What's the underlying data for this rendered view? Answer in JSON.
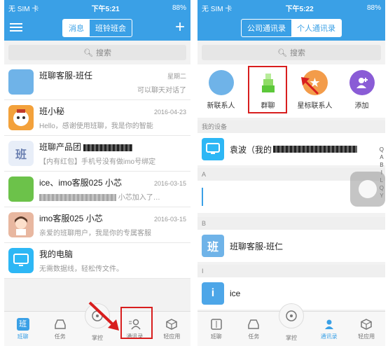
{
  "left": {
    "status": {
      "carrier": "无 SIM 卡",
      "time": "下午5:21",
      "battery": "88%"
    },
    "nav": {
      "seg_active": "消息",
      "seg_inactive": "班铃班会",
      "add": "+"
    },
    "search_placeholder": "搜索",
    "chats": [
      {
        "name": "班聊客服-班任",
        "date": "星期二",
        "preview": "可以聊天对话了",
        "color": "#6fb3e8"
      },
      {
        "name": "班小秘",
        "date": "2016-04-23",
        "preview": "Hello，感谢使用班聊，我是你的智能",
        "color": "#f3a13b"
      },
      {
        "name": "班聊产品团",
        "date": "",
        "preview": "【内有红包】手机号没有做imo号绑定",
        "color": "#c8d4ea",
        "avatar_text": "班"
      },
      {
        "name": "ice、imo客服025 小芯",
        "date": "2016-03-15",
        "preview": "小芯加入了…",
        "color": "#6cc24a"
      },
      {
        "name": "imo客服025 小芯",
        "date": "2016-03-15",
        "preview": "亲爱的班聊用户，我是你的专属客服",
        "color": "#e8b7a0"
      },
      {
        "name": "我的电脑",
        "date": "",
        "preview": "无需数据线，轻松传文件。",
        "color": "#2db7f5"
      }
    ],
    "tabs": [
      "班聊",
      "任务",
      "掌控",
      "通讯录",
      "轻应用"
    ],
    "first_tab_icon_text": "班"
  },
  "right": {
    "status": {
      "carrier": "无 SIM 卡",
      "time": "下午5:22",
      "battery": "88%"
    },
    "nav": {
      "seg_inactive": "公司通讯录",
      "seg_active": "个人通讯录"
    },
    "search_placeholder": "搜索",
    "quick": [
      {
        "label": "新联系人",
        "color": "#6fb3e8"
      },
      {
        "label": "群聊",
        "color": "#7ed35a"
      },
      {
        "label": "星标联系人",
        "color": "#f39c4a"
      },
      {
        "label": "添加",
        "color": "#8a5cd6"
      }
    ],
    "sections": {
      "devices": "我的设备",
      "a": "A",
      "b": "B",
      "i": "I"
    },
    "contacts": {
      "device": "袁波（我的",
      "banliao": "班聊客服-班仁",
      "ice": "ice"
    },
    "avatar_texts": {
      "banliao": "班",
      "ice": "i"
    },
    "index_letters": [
      "Q",
      "A",
      "B",
      "I",
      "L",
      "Q",
      "Y"
    ],
    "tabs": [
      "班聊",
      "任务",
      "掌控",
      "通讯录",
      "轻应用"
    ]
  },
  "colors": {
    "accent": "#3aa0e6",
    "highlight": "#d81e1e"
  }
}
